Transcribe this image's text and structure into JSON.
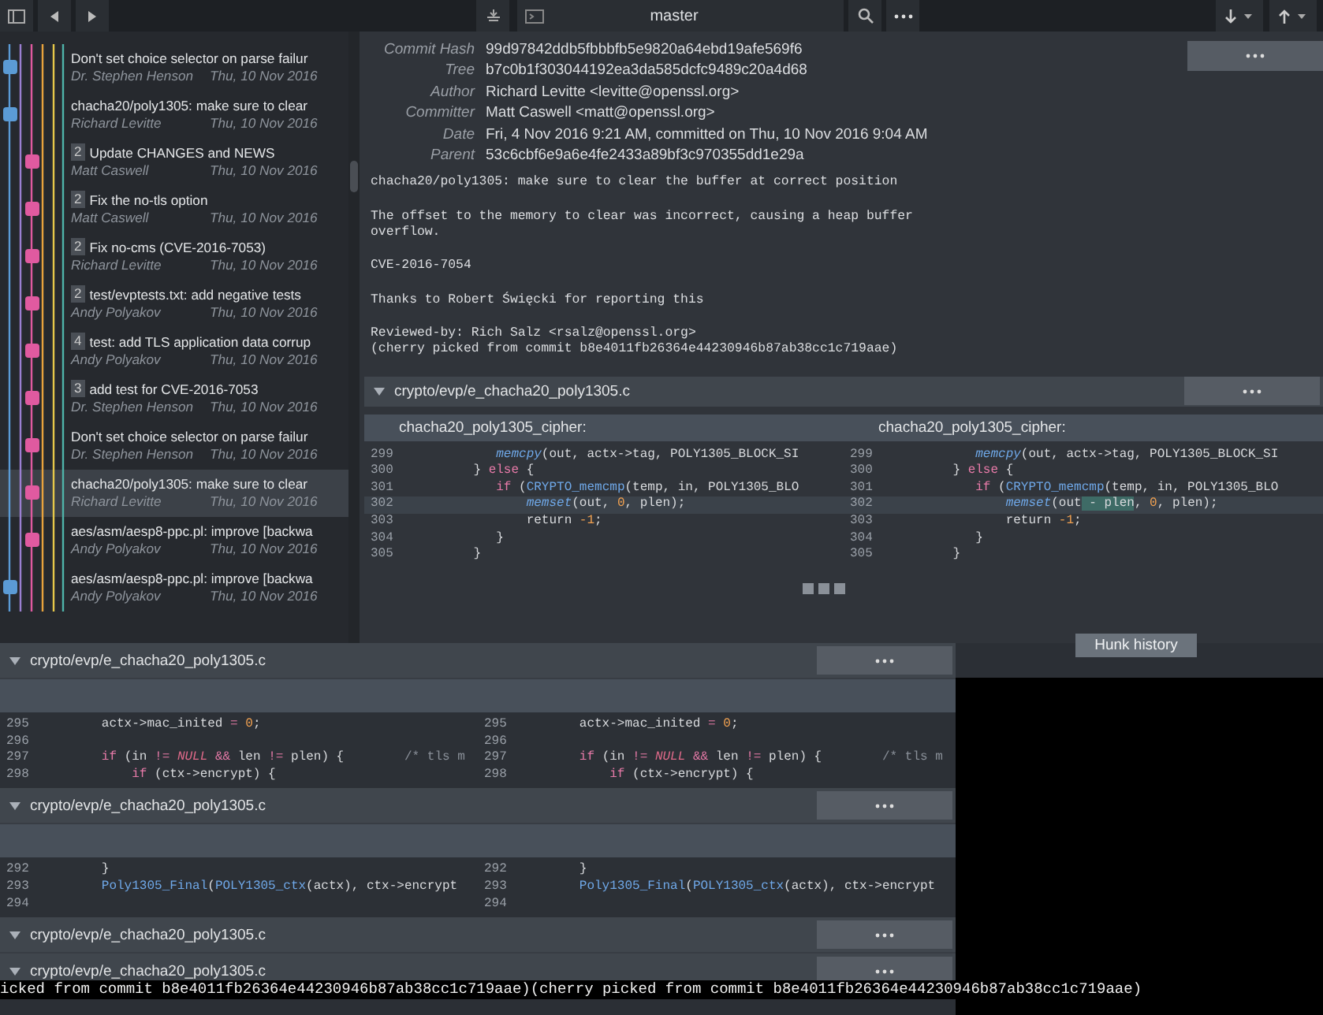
{
  "toolbar": {
    "branch": "master"
  },
  "commits": [
    {
      "title": "Don't set choice selector on parse failur",
      "author": "Dr. Stephen Henson",
      "date": "Thu, 10 Nov 2016",
      "selected": false,
      "kind": "main",
      "color": "#5b9bd5"
    },
    {
      "title": "chacha20/poly1305: make sure to clear",
      "author": "Richard Levitte",
      "date": "Thu, 10 Nov 2016",
      "selected": false,
      "kind": "main",
      "color": "#5b9bd5"
    },
    {
      "badge": "2",
      "title": "Update CHANGES and NEWS",
      "author": "Matt Caswell",
      "date": "Thu, 10 Nov 2016",
      "selected": false,
      "kind": "side",
      "color": "#e05aa0"
    },
    {
      "badge": "2",
      "title": "Fix the no-tls option",
      "author": "Matt Caswell",
      "date": "Thu, 10 Nov 2016",
      "selected": false,
      "kind": "side",
      "color": "#e05aa0"
    },
    {
      "badge": "2",
      "title": "Fix no-cms (CVE-2016-7053)",
      "author": "Richard Levitte",
      "date": "Thu, 10 Nov 2016",
      "selected": false,
      "kind": "side",
      "color": "#e05aa0"
    },
    {
      "badge": "2",
      "title": "test/evptests.txt: add negative tests",
      "author": "Andy Polyakov",
      "date": "Thu, 10 Nov 2016",
      "selected": false,
      "kind": "side",
      "color": "#e05aa0"
    },
    {
      "badge": "4",
      "title": "test: add TLS application data corrup",
      "author": "Andy Polyakov",
      "date": "Thu, 10 Nov 2016",
      "selected": false,
      "kind": "side",
      "color": "#e05aa0"
    },
    {
      "badge": "3",
      "title": "add test for CVE-2016-7053",
      "author": "Dr. Stephen Henson",
      "date": "Thu, 10 Nov 2016",
      "selected": false,
      "kind": "side",
      "color": "#e05aa0"
    },
    {
      "title": "Don't set choice selector on parse failur",
      "author": "Dr. Stephen Henson",
      "date": "Thu, 10 Nov 2016",
      "selected": false,
      "kind": "side",
      "color": "#e05aa0"
    },
    {
      "title": "chacha20/poly1305: make sure to clear",
      "author": "Richard Levitte",
      "date": "Thu, 10 Nov 2016",
      "selected": true,
      "kind": "side",
      "color": "#e05aa0"
    },
    {
      "title": "aes/asm/aesp8-ppc.pl: improve [backwa",
      "author": "Andy Polyakov",
      "date": "Thu, 10 Nov 2016",
      "selected": false,
      "kind": "side",
      "color": "#e05aa0"
    },
    {
      "title": "aes/asm/aesp8-ppc.pl: improve [backwa",
      "author": "Andy Polyakov",
      "date": "Thu, 10 Nov 2016",
      "selected": false,
      "kind": "main",
      "color": "#5b9bd5"
    }
  ],
  "details": {
    "fields": [
      {
        "label": "Commit Hash",
        "value": "99d97842ddb5fbbbfb5e9820a64ebd19afe569f6"
      },
      {
        "label": "Tree",
        "value": "b7c0b1f303044192ea3da585dcfc9489c20a4d68"
      },
      {
        "label": "Author",
        "value": "Richard Levitte <levitte@openssl.org>"
      },
      {
        "label": "Committer",
        "value": "Matt Caswell <matt@openssl.org>"
      },
      {
        "label": "Date",
        "value": "Fri, 4 Nov 2016 9:21 AM, committed on Thu, 10 Nov 2016 9:04 AM"
      },
      {
        "label": "Parent",
        "value": "53c6cbf6e9a6e4fe2433a89bf3c970355dd1e29a"
      }
    ],
    "message": [
      "chacha20/poly1305: make sure to clear the buffer at correct position",
      "The offset to the memory to clear was incorrect, causing a heap buffer\noverflow.",
      "CVE-2016-7054",
      "Thanks to Robert Święcki for reporting this",
      "Reviewed-by: Rich Salz <rsalz@openssl.org>\n(cherry picked from commit b8e4011fb26364e44230946b87ab38cc1c719aae)"
    ],
    "file": {
      "path": "crypto/evp/e_chacha20_poly1305.c",
      "expanded": true,
      "left_function": "chacha20_poly1305_cipher:",
      "right_function": "chacha20_poly1305_cipher:",
      "lines": [
        {
          "left_no": "299",
          "right_no": "299",
          "selected": false,
          "left": [
            {
              "text": "            memcpy",
              "kind": "fn"
            },
            {
              "text": "(out, actx->tag, POLY1305_BLOCK_SI",
              "kind": "plain"
            }
          ],
          "right": [
            {
              "text": "            memcpy",
              "kind": "fn"
            },
            {
              "text": "(out, actx->tag, POLY1305_BLOCK_SI",
              "kind": "plain"
            }
          ]
        },
        {
          "left_no": "300",
          "right_no": "300",
          "selected": false,
          "left": [
            {
              "text": "         } ",
              "kind": "plain"
            },
            {
              "text": "else",
              "kind": "keyword"
            },
            {
              "text": " {",
              "kind": "plain"
            }
          ],
          "right": [
            {
              "text": "         } ",
              "kind": "plain"
            },
            {
              "text": "else",
              "kind": "keyword"
            },
            {
              "text": " {",
              "kind": "plain"
            }
          ]
        },
        {
          "left_no": "301",
          "right_no": "301",
          "selected": false,
          "left": [
            {
              "text": "            if",
              "kind": "keyword"
            },
            {
              "text": " (",
              "kind": "plain"
            },
            {
              "text": "CRYPTO_memcmp",
              "kind": "call"
            },
            {
              "text": "(temp, in, POLY1305_BLO",
              "kind": "plain"
            }
          ],
          "right": [
            {
              "text": "            if",
              "kind": "keyword"
            },
            {
              "text": " (",
              "kind": "plain"
            },
            {
              "text": "CRYPTO_memcmp",
              "kind": "call"
            },
            {
              "text": "(temp, in, POLY1305_BLO",
              "kind": "plain"
            }
          ]
        },
        {
          "left_no": "302",
          "right_no": "302",
          "selected": true,
          "left": [
            {
              "text": "                memset",
              "kind": "fn"
            },
            {
              "text": "(out, ",
              "kind": "plain"
            },
            {
              "text": "0",
              "kind": "number"
            },
            {
              "text": ", plen);",
              "kind": "plain"
            }
          ],
          "right": [
            {
              "text": "                memset",
              "kind": "fn"
            },
            {
              "text": "(out",
              "kind": "plain"
            },
            {
              "text": " - plen",
              "kind": "added"
            },
            {
              "text": ", ",
              "kind": "plain"
            },
            {
              "text": "0",
              "kind": "number"
            },
            {
              "text": ", plen);",
              "kind": "plain"
            }
          ]
        },
        {
          "left_no": "303",
          "right_no": "303",
          "selected": false,
          "left": [
            {
              "text": "                return ",
              "kind": "plain"
            },
            {
              "text": "-1",
              "kind": "number"
            },
            {
              "text": ";",
              "kind": "plain"
            }
          ],
          "right": [
            {
              "text": "                return ",
              "kind": "plain"
            },
            {
              "text": "-1",
              "kind": "number"
            },
            {
              "text": ";",
              "kind": "plain"
            }
          ]
        },
        {
          "left_no": "304",
          "right_no": "304",
          "selected": false,
          "left": [
            {
              "text": "            }",
              "kind": "plain"
            }
          ],
          "right": [
            {
              "text": "            }",
              "kind": "plain"
            }
          ]
        },
        {
          "left_no": "305",
          "right_no": "305",
          "selected": false,
          "left": [
            {
              "text": "         }",
              "kind": "plain"
            }
          ],
          "right": [
            {
              "text": "         }",
              "kind": "plain"
            }
          ]
        }
      ]
    }
  },
  "overlay": {
    "sections": [
      {
        "path": "crypto/evp/e_chacha20_poly1305.c",
        "expanded": true,
        "lines": [
          {
            "left_no": "295",
            "right_no": "295",
            "selected": false,
            "left": [
              {
                "text": "        actx->mac_inited ",
                "kind": "plain"
              },
              {
                "text": "= ",
                "kind": "keyword"
              },
              {
                "text": "0",
                "kind": "number"
              },
              {
                "text": ";",
                "kind": "plain"
              }
            ],
            "right": [
              {
                "text": "        actx->mac_inited ",
                "kind": "plain"
              },
              {
                "text": "= ",
                "kind": "keyword"
              },
              {
                "text": "0",
                "kind": "number"
              },
              {
                "text": ";",
                "kind": "plain"
              }
            ]
          },
          {
            "left_no": "296",
            "right_no": "296",
            "selected": false
          },
          {
            "left_no": "297",
            "right_no": "297",
            "selected": false,
            "left": [
              {
                "text": "        if",
                "kind": "keyword"
              },
              {
                "text": " (in ",
                "kind": "plain"
              },
              {
                "text": "!= ",
                "kind": "keyword"
              },
              {
                "text": "NULL ",
                "kind": "constant"
              },
              {
                "text": "&&",
                "kind": "keyword"
              },
              {
                "text": " len ",
                "kind": "plain"
              },
              {
                "text": "!=",
                "kind": "keyword"
              },
              {
                "text": " plen) {        ",
                "kind": "plain"
              },
              {
                "text": "/* tls m",
                "kind": "comment"
              }
            ],
            "right": [
              {
                "text": "        if",
                "kind": "keyword"
              },
              {
                "text": " (in ",
                "kind": "plain"
              },
              {
                "text": "!= ",
                "kind": "keyword"
              },
              {
                "text": "NULL ",
                "kind": "constant"
              },
              {
                "text": "&&",
                "kind": "keyword"
              },
              {
                "text": " len ",
                "kind": "plain"
              },
              {
                "text": "!=",
                "kind": "keyword"
              },
              {
                "text": " plen) {        ",
                "kind": "plain"
              },
              {
                "text": "/* tls m",
                "kind": "comment"
              }
            ]
          },
          {
            "left_no": "298",
            "right_no": "298",
            "selected": false,
            "left": [
              {
                "text": "            if",
                "kind": "keyword"
              },
              {
                "text": " (ctx->encrypt) {",
                "kind": "plain"
              }
            ],
            "right": [
              {
                "text": "            if",
                "kind": "keyword"
              },
              {
                "text": " (ctx->encrypt) {",
                "kind": "plain"
              }
            ]
          }
        ]
      },
      {
        "path": "crypto/evp/e_chacha20_poly1305.c",
        "expanded": true,
        "lines": [
          {
            "left_no": "292",
            "right_no": "292",
            "selected": false,
            "left": [
              {
                "text": "        }",
                "kind": "plain"
              }
            ],
            "right": [
              {
                "text": "        }",
                "kind": "plain"
              }
            ]
          },
          {
            "left_no": "293",
            "right_no": "293",
            "selected": false,
            "left": [
              {
                "text": "        Poly1305_Final",
                "kind": "call"
              },
              {
                "text": "(",
                "kind": "plain"
              },
              {
                "text": "POLY1305_ctx",
                "kind": "call"
              },
              {
                "text": "(actx), ctx->encrypt",
                "kind": "plain"
              }
            ],
            "right": [
              {
                "text": "        Poly1305_Final",
                "kind": "call"
              },
              {
                "text": "(",
                "kind": "plain"
              },
              {
                "text": "POLY1305_ctx",
                "kind": "call"
              },
              {
                "text": "(actx), ctx->encrypt",
                "kind": "plain"
              }
            ]
          },
          {
            "left_no": "294",
            "right_no": "294",
            "selected": false
          }
        ]
      },
      {
        "path": "crypto/evp/e_chacha20_poly1305.c",
        "expanded": true
      },
      {
        "path": "crypto/evp/e_chacha20_poly1305.c",
        "expanded": true
      }
    ],
    "strip": [
      "icked from commit b8e4011fb26364e44230946b87ab38cc1c719aae)",
      "(cherry picked from commit b8e4011fb26364e44230946b87ab38cc1c719aae)"
    ],
    "tooltip": "Hunk history"
  }
}
